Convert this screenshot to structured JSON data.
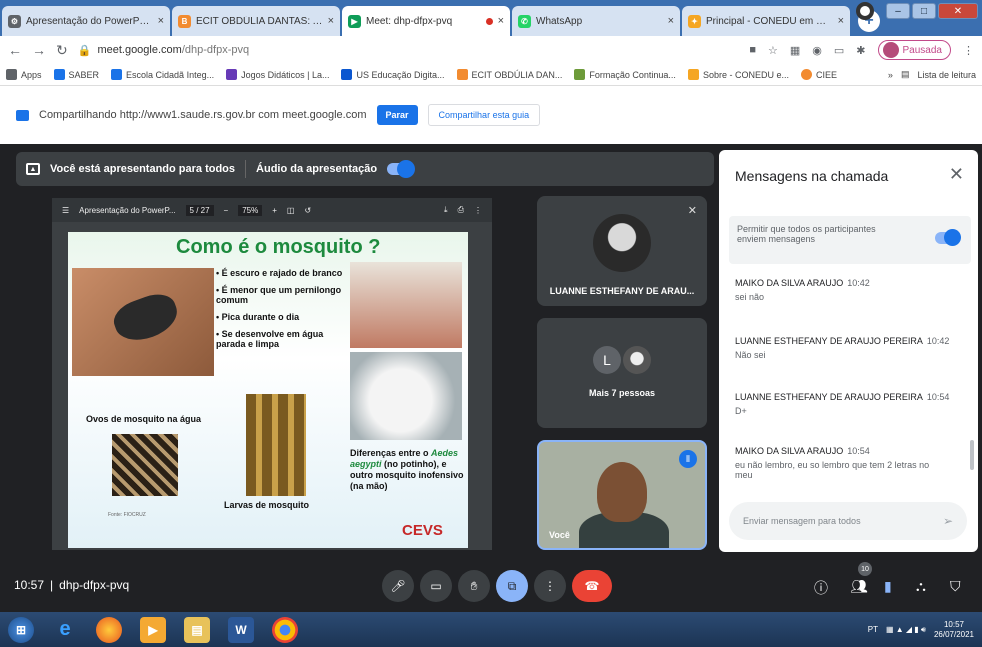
{
  "browser": {
    "tabs": [
      {
        "label": "Apresentação do PowerPoint",
        "favicon_color": "#5f6368",
        "close": "×"
      },
      {
        "label": "ECIT OBDÚLIA DANTAS: Aulas",
        "favicon_color": "#f28b30",
        "close": "×"
      },
      {
        "label": "Meet: dhp-dfpx-pvq",
        "favicon_color": "#0f9d58",
        "close": "×",
        "active": true
      },
      {
        "label": "WhatsApp",
        "favicon_color": "#25d366",
        "close": "×"
      },
      {
        "label": "Principal - CONEDU em Maceió",
        "favicon_color": "#f5a623",
        "close": "×"
      }
    ],
    "new_tab": "+",
    "address": {
      "domain": "meet.google.com",
      "path": "/dhp-dfpx-pvq"
    },
    "profile_status": "Pausada",
    "bookmarks": [
      {
        "label": "Apps",
        "color": "#5f6368"
      },
      {
        "label": "SABER",
        "color": "#1a73e8"
      },
      {
        "label": "Escola Cidadã Integ...",
        "color": "#1a73e8"
      },
      {
        "label": "Jogos Didáticos | La...",
        "color": "#673ab7"
      },
      {
        "label": "US Educação Digita...",
        "color": "#0b57d0"
      },
      {
        "label": "ECIT OBDÚLIA DAN...",
        "color": "#f28b30"
      },
      {
        "label": "Formação Continua...",
        "color": "#6d9b3a"
      },
      {
        "label": "Sobre - CONEDU e...",
        "color": "#f5a623"
      },
      {
        "label": "CIEE",
        "color": "#f28b30"
      }
    ],
    "bookmarks_more": "»",
    "reading_list": "Lista de leitura"
  },
  "sharebar": {
    "text": "Compartilhando http://www1.saude.rs.gov.br com meet.google.com",
    "stop_label": "Parar",
    "share_tab_label": "Compartilhar esta guia"
  },
  "meet": {
    "present_label": "Você está apresentando para todos",
    "audio_label": "Áudio da apresentação",
    "slide_toolbar": {
      "title": "Apresentação do PowerP...",
      "page": "5 / 27",
      "zoom": "75%"
    },
    "slide": {
      "title": "Como é o mosquito ?",
      "bullets": [
        "É escuro e rajado de branco",
        "É menor que um pernilongo comum",
        "Pica durante o dia",
        "Se desenvolve em água parada e limpa"
      ],
      "eggs_label": "Ovos de mosquito na água",
      "larvae_label": "Larvas de mosquito",
      "diff_pre": "Diferenças entre o",
      "diff_species": "Aedes aegypti",
      "diff_post": "(no potinho), e outro mosquito inofensivo (na mão)",
      "logo": "CEVS",
      "source": "Fonte: FIOCRUZ"
    },
    "participants": {
      "main_name": "LUANNE ESTHEFANY DE ARAU...",
      "more_initial": "L",
      "more_label": "Mais 7 pessoas",
      "you_label": "Você"
    },
    "chat": {
      "title": "Mensagens na chamada",
      "allow_text": "Permitir que todos os participantes enviem mensagens",
      "messages": [
        {
          "sender": "MAIKO DA SILVA ARAUJO",
          "time": "10:42",
          "text": "sei não"
        },
        {
          "sender": "LUANNE ESTHEFANY DE ARAUJO PEREIRA",
          "time": "10:42",
          "text": "Não sei"
        },
        {
          "sender": "LUANNE ESTHEFANY DE ARAUJO PEREIRA",
          "time": "10:54",
          "text": "D+"
        },
        {
          "sender": "MAIKO DA SILVA ARAUJO",
          "time": "10:54",
          "text": "eu não lembro, eu so lembro que tem 2 letras no meu"
        }
      ],
      "input_placeholder": "Enviar mensagem para todos"
    },
    "bottom": {
      "time": "10:57",
      "separator": "|",
      "code": "dhp-dfpx-pvq",
      "participant_count": "10"
    }
  },
  "taskbar": {
    "lang": "PT",
    "time": "10:57",
    "date": "26/07/2021"
  }
}
